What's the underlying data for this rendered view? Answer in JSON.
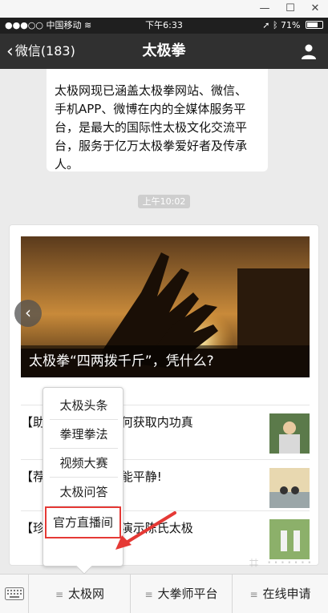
{
  "window": {
    "minimize": "—",
    "maximize": "☐",
    "close": "✕"
  },
  "status": {
    "carrier": "中国移动",
    "time": "下午6:33",
    "battery": "71%",
    "battery_level": 0.71
  },
  "nav": {
    "back_label": "微信(183)",
    "title": "太极拳"
  },
  "intro_bubble": {
    "text": "太极网现已涵盖太极拳网站、微信、手机APP、微博在内的全媒体服务平台，是最大的国际性太极文化交流平台，服务于亿万太极拳爱好者及传承人。"
  },
  "timestamp": "上午10:02",
  "card": {
    "hero_caption": "太极拳“四两拨千斤”，凭什么?",
    "articles": [
      {
        "text": "【助                习练太极拳如何获取内功真"
      },
      {
        "text": "【荐                ，看完久久不能平静!"
      },
      {
        "text": "【珍             战军和张保忠演示陈氏太极"
      }
    ]
  },
  "popup_menu": {
    "items": [
      "太极头条",
      "拳理拳法",
      "视频大赛",
      "太极问答",
      "官方直播间"
    ]
  },
  "bottom_menu": {
    "items": [
      "太极网",
      "大拳师平台",
      "在线申请"
    ]
  },
  "colors": {
    "navbar": "#303030",
    "highlight": "#e53935"
  }
}
